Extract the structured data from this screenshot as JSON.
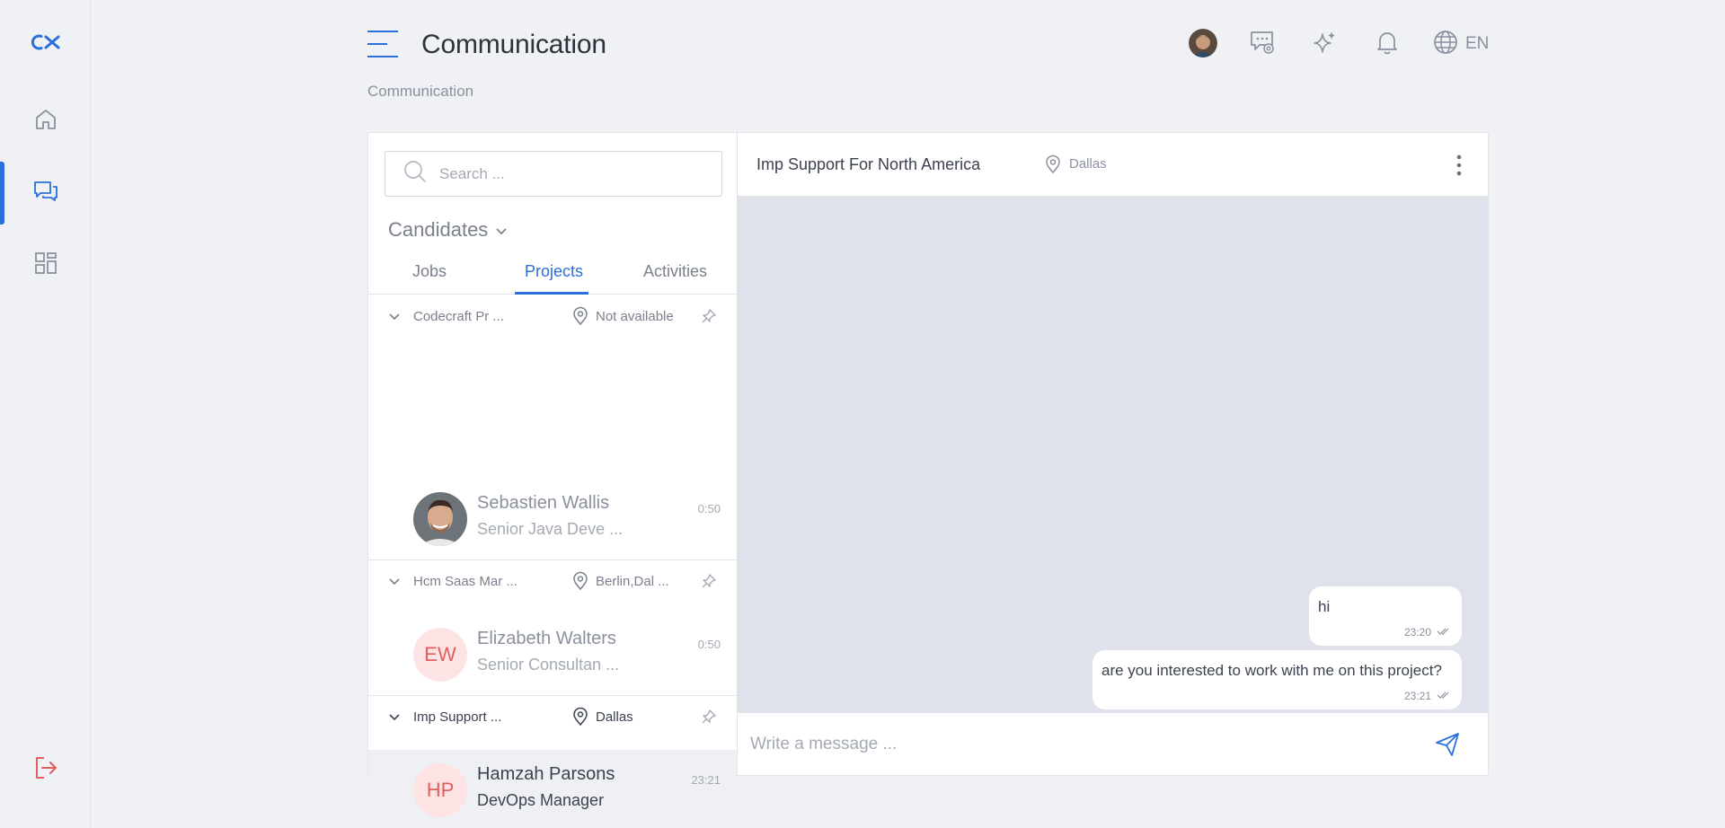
{
  "brand": {
    "logo_text": "CX",
    "accent": "#2a6fdb",
    "logout_color": "#e25f5f"
  },
  "rail": {
    "items": [
      {
        "name": "home",
        "icon": "home-icon"
      },
      {
        "name": "communication",
        "icon": "chat-icon",
        "active": true
      },
      {
        "name": "dashboard",
        "icon": "grid-icon"
      }
    ],
    "logout_icon": "logout-icon"
  },
  "header": {
    "title": "Communication",
    "breadcrumb": "Communication",
    "language": "EN",
    "icons": [
      "user-avatar",
      "chat-settings-icon",
      "sparkle-icon",
      "bell-icon",
      "globe-icon"
    ]
  },
  "search": {
    "placeholder": "Search ..."
  },
  "filter": {
    "label": "Candidates"
  },
  "tabs": [
    {
      "label": "Jobs"
    },
    {
      "label": "Projects",
      "active": true
    },
    {
      "label": "Activities"
    }
  ],
  "groups": [
    {
      "name": "Codecraft Pr ...",
      "location": "Not available",
      "contact": {
        "name": "Sebastien Wallis",
        "role": "Senior Java Deve ...",
        "time": "0:50",
        "initials": ""
      }
    },
    {
      "name": "Hcm Saas Mar ...",
      "location": "Berlin,Dal ...",
      "contact": {
        "name": "Elizabeth Walters",
        "role": "Senior Consultan ...",
        "time": "0:50",
        "initials": "EW"
      }
    },
    {
      "name": "Imp Support ...",
      "location": "Dallas",
      "contact": {
        "name": "Hamzah Parsons",
        "role": "DevOps Manager",
        "time": "23:21",
        "initials": "HP",
        "selected": true
      }
    }
  ],
  "chat": {
    "title": "Imp Support For North America",
    "location": "Dallas",
    "messages": [
      {
        "text": "hi",
        "time": "23:20"
      },
      {
        "text": "are you interested to work with me on this project?",
        "time": "23:21"
      }
    ],
    "composer_placeholder": "Write a message ..."
  }
}
